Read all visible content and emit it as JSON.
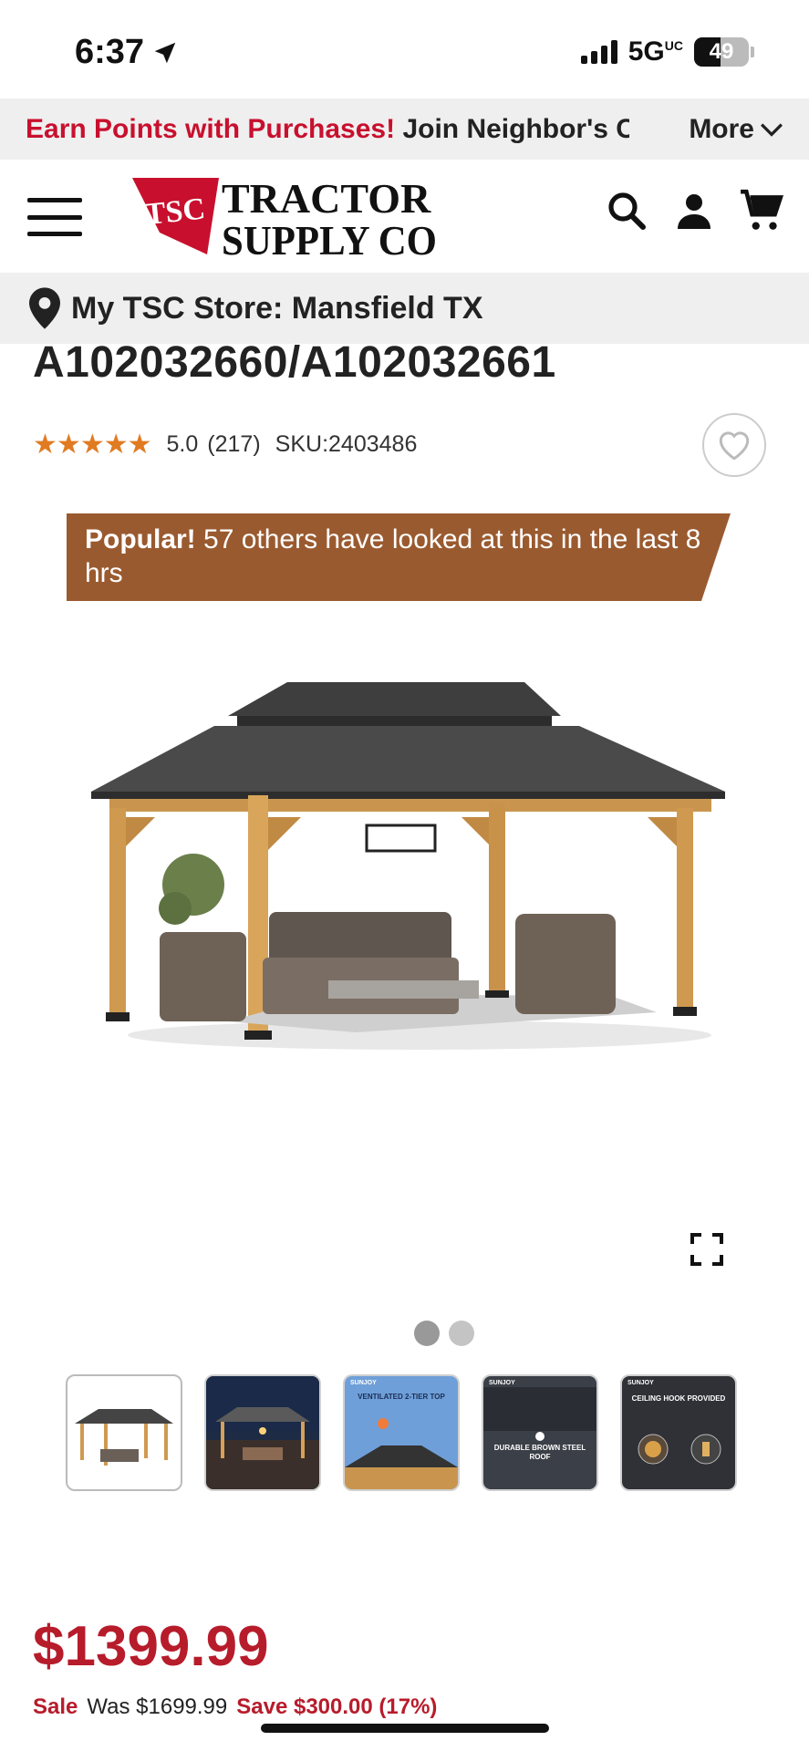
{
  "status_bar": {
    "time": "6:37",
    "network": "5G",
    "network_suffix": "UC",
    "battery": "49",
    "battery_level": 0.49
  },
  "promo": {
    "highlight": "Earn Points with Purchases!",
    "text": " Join Neighbor's Club",
    "more_label": "More"
  },
  "header": {
    "logo_badge": "TSC",
    "logo_line1": "TRACTOR",
    "logo_line2": "SUPPLY CO"
  },
  "store": {
    "label": "My TSC Store: Mansfield TX"
  },
  "product": {
    "title": "A102032660/A102032661",
    "rating": "5.0",
    "rating_stars": 5,
    "review_count": "(217)",
    "sku": "SKU:2403486"
  },
  "popular": {
    "bold": "Popular!",
    "text": " 57 others have looked at this in the last 8 hrs"
  },
  "gallery": {
    "thumbnails": [
      {
        "caption": "",
        "brand": ""
      },
      {
        "caption": "",
        "brand": ""
      },
      {
        "caption": "VENTILATED 2-TIER TOP",
        "brand": "SUNJOY"
      },
      {
        "caption": "DURABLE BROWN STEEL ROOF",
        "brand": "SUNJOY"
      },
      {
        "caption": "CEILING HOOK PROVIDED",
        "brand": "SUNJOY"
      }
    ]
  },
  "pricing": {
    "price": "$1399.99",
    "sale_label": "Sale",
    "was": "Was $1699.99",
    "save": "Save $300.00 (17%)"
  },
  "colors": {
    "brand_red": "#c8102e",
    "price_red": "#b71c2b",
    "banner_brown": "#9a5a2f",
    "star_orange": "#e07b22"
  }
}
